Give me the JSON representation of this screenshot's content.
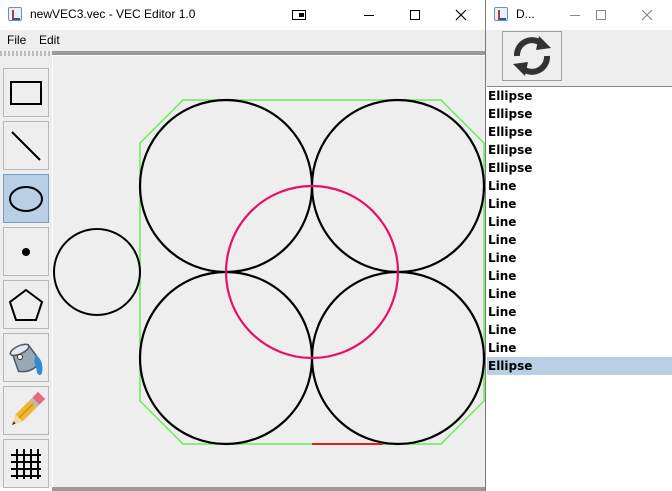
{
  "main_window": {
    "title": "newVEC3.vec - VEC Editor 1.0",
    "menu": [
      "File",
      "Edit"
    ],
    "tools": [
      {
        "name": "rectangle-tool",
        "icon": "rectangle-icon",
        "selected": false
      },
      {
        "name": "line-tool",
        "icon": "line-icon",
        "selected": false
      },
      {
        "name": "ellipse-tool",
        "icon": "ellipse-icon",
        "selected": true
      },
      {
        "name": "plot-tool",
        "icon": "dot-icon",
        "selected": false
      },
      {
        "name": "polygon-tool",
        "icon": "pentagon-icon",
        "selected": false
      },
      {
        "name": "fill-tool",
        "icon": "paint-bucket-icon",
        "selected": false
      },
      {
        "name": "pen-colour-tool",
        "icon": "pencil-icon",
        "selected": false
      },
      {
        "name": "grid-tool",
        "icon": "grid-icon",
        "selected": false
      }
    ]
  },
  "side_window": {
    "title": "D...",
    "refresh_icon": "refresh-icon",
    "items": [
      "Ellipse",
      "Ellipse",
      "Ellipse",
      "Ellipse",
      "Ellipse",
      "Line",
      "Line",
      "Line",
      "Line",
      "Line",
      "Line",
      "Line",
      "Line",
      "Line",
      "Line",
      "Ellipse"
    ],
    "selected_index": 15
  },
  "colors": {
    "selection": "#b8cfe5",
    "outline_green": "#66ee55",
    "highlight_pink": "#e8106a",
    "line_red": "#e02020"
  }
}
